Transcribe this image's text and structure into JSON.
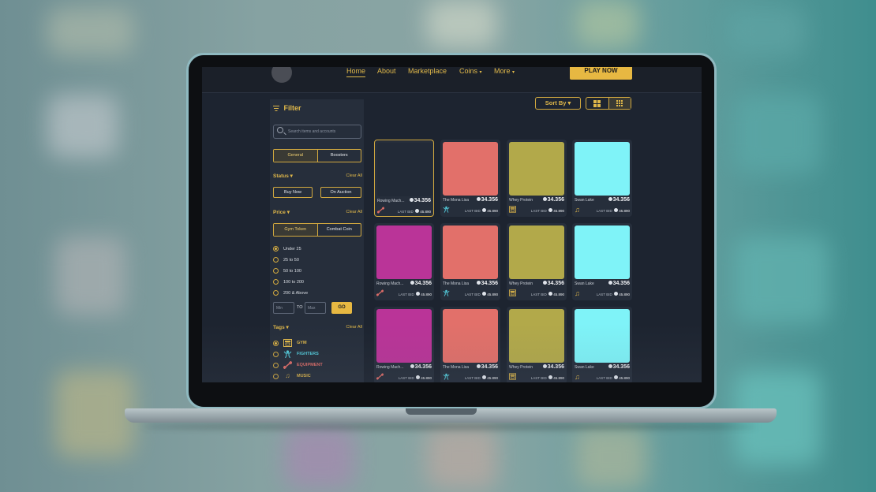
{
  "colors": {
    "accent": "#e0b84a",
    "screen_bg": "#1d2430",
    "panel_bg": "#262e3b",
    "thumb_red": "#e2706a",
    "thumb_olive": "#b2a94a",
    "thumb_cyan": "#7ff3f8",
    "thumb_magenta": "#ba3498",
    "thumb_dark": "#222a37"
  },
  "nav": {
    "items": [
      {
        "label": "Home"
      },
      {
        "label": "About"
      },
      {
        "label": "Marketplace"
      },
      {
        "label": "Coins",
        "caret": "▾"
      },
      {
        "label": "More",
        "caret": "▾"
      }
    ],
    "play_label": "PLAY NOW"
  },
  "sidebar": {
    "filter_title": "Filter",
    "search_placeholder": "Search items and accounts",
    "seg1": [
      "General",
      "Boosters"
    ],
    "status_title": "Status ▾",
    "clear_all": "Clear All",
    "status_buttons": [
      "Buy Now",
      "On Auction"
    ],
    "price_title": "Price ▾",
    "seg2": [
      "Gym Token",
      "Combat Coin"
    ],
    "price_ranges": [
      "Under 25",
      "25 to 50",
      "50 to 100",
      "100 to 200",
      "200 & Above"
    ],
    "min_placeholder": "Min",
    "to_label": "TO",
    "max_placeholder": "Max",
    "go_label": "GO",
    "tags_title": "Tags ▾",
    "tags": [
      {
        "label": "GYM",
        "color": "#e0b84a",
        "icon": "gym-icon"
      },
      {
        "label": "FIGHTERS",
        "color": "#52c8d8",
        "icon": "fighter-icon"
      },
      {
        "label": "EQUIPMENT",
        "color": "#d86a66",
        "icon": "dumbbell-icon"
      },
      {
        "label": "MUSIC",
        "color": "#d6b04a",
        "icon": "music-note-icon"
      }
    ]
  },
  "toolbar": {
    "sort_label": "Sort By ▾"
  },
  "cards": [
    {
      "name": "Rowing Mach...",
      "price": "34.356",
      "last_bid_label": "LAST BID",
      "last_bid": "45.890",
      "thumb": "#222a37",
      "icon": "dumbbell-icon"
    },
    {
      "name": "The Mona Lisa",
      "price": "34.356",
      "last_bid_label": "LAST BID",
      "last_bid": "45.890",
      "thumb": "#e2706a",
      "icon": "fighter-icon"
    },
    {
      "name": "Whey Protein",
      "price": "34.356",
      "last_bid_label": "LAST BID",
      "last_bid": "45.890",
      "thumb": "#b2a94a",
      "icon": "gym-icon"
    },
    {
      "name": "Swan Lake",
      "price": "34.356",
      "last_bid_label": "LAST BID",
      "last_bid": "45.890",
      "thumb": "#7ff3f8",
      "icon": "music-note-icon"
    },
    {
      "name": "Rowing Mach...",
      "price": "34.356",
      "last_bid_label": "LAST BID",
      "last_bid": "45.890",
      "thumb": "#ba3498",
      "icon": "dumbbell-icon"
    },
    {
      "name": "The Mona Lisa",
      "price": "34.356",
      "last_bid_label": "LAST BID",
      "last_bid": "45.890",
      "thumb": "#e2706a",
      "icon": "fighter-icon"
    },
    {
      "name": "Whey Protein",
      "price": "34.356",
      "last_bid_label": "LAST BID",
      "last_bid": "45.890",
      "thumb": "#b2a94a",
      "icon": "gym-icon"
    },
    {
      "name": "Swan Lake",
      "price": "34.356",
      "last_bid_label": "LAST BID",
      "last_bid": "45.890",
      "thumb": "#7ff3f8",
      "icon": "music-note-icon"
    },
    {
      "name": "Rowing Mach...",
      "price": "34.356",
      "last_bid_label": "LAST BID",
      "last_bid": "45.890",
      "thumb": "#ba3498",
      "icon": "dumbbell-icon"
    },
    {
      "name": "The Mona Lisa",
      "price": "34.356",
      "last_bid_label": "LAST BID",
      "last_bid": "45.890",
      "thumb": "#e2706a",
      "icon": "fighter-icon"
    },
    {
      "name": "Whey Protein",
      "price": "34.356",
      "last_bid_label": "LAST BID",
      "last_bid": "45.890",
      "thumb": "#b2a94a",
      "icon": "gym-icon"
    },
    {
      "name": "Swan Lake",
      "price": "34.356",
      "last_bid_label": "LAST BID",
      "last_bid": "45.890",
      "thumb": "#7ff3f8",
      "icon": "music-note-icon"
    }
  ]
}
